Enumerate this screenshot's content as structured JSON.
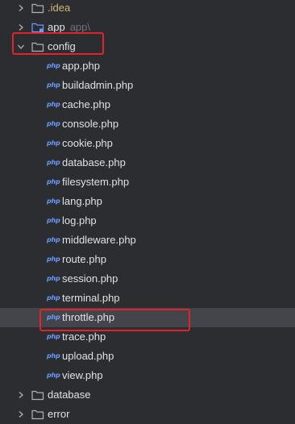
{
  "tree": {
    "top_items": [
      {
        "name": ".idea",
        "hint": ""
      },
      {
        "name": "app",
        "hint": "app\\"
      }
    ],
    "open_folder": {
      "name": "config"
    },
    "files": [
      {
        "icon": "php",
        "name": "app.php"
      },
      {
        "icon": "php",
        "name": "buildadmin.php"
      },
      {
        "icon": "php",
        "name": "cache.php"
      },
      {
        "icon": "php",
        "name": "console.php"
      },
      {
        "icon": "php",
        "name": "cookie.php"
      },
      {
        "icon": "php",
        "name": "database.php"
      },
      {
        "icon": "php",
        "name": "filesystem.php"
      },
      {
        "icon": "php",
        "name": "lang.php"
      },
      {
        "icon": "php",
        "name": "log.php"
      },
      {
        "icon": "php",
        "name": "middleware.php"
      },
      {
        "icon": "php",
        "name": "route.php"
      },
      {
        "icon": "php",
        "name": "session.php"
      },
      {
        "icon": "php",
        "name": "terminal.php"
      },
      {
        "icon": "php",
        "name": "throttle.php"
      },
      {
        "icon": "php",
        "name": "trace.php"
      },
      {
        "icon": "php",
        "name": "upload.php"
      },
      {
        "icon": "php",
        "name": "view.php"
      }
    ],
    "bottom_items": [
      {
        "name": "database"
      },
      {
        "name": "error"
      }
    ]
  },
  "colors": {
    "background": "#2b2d30",
    "text": "#dfe1e5",
    "php_icon": "#6b9bfa",
    "selection": "#43454a",
    "highlight_box": "#e0242a",
    "idea_folder_text": "#d5b778"
  }
}
